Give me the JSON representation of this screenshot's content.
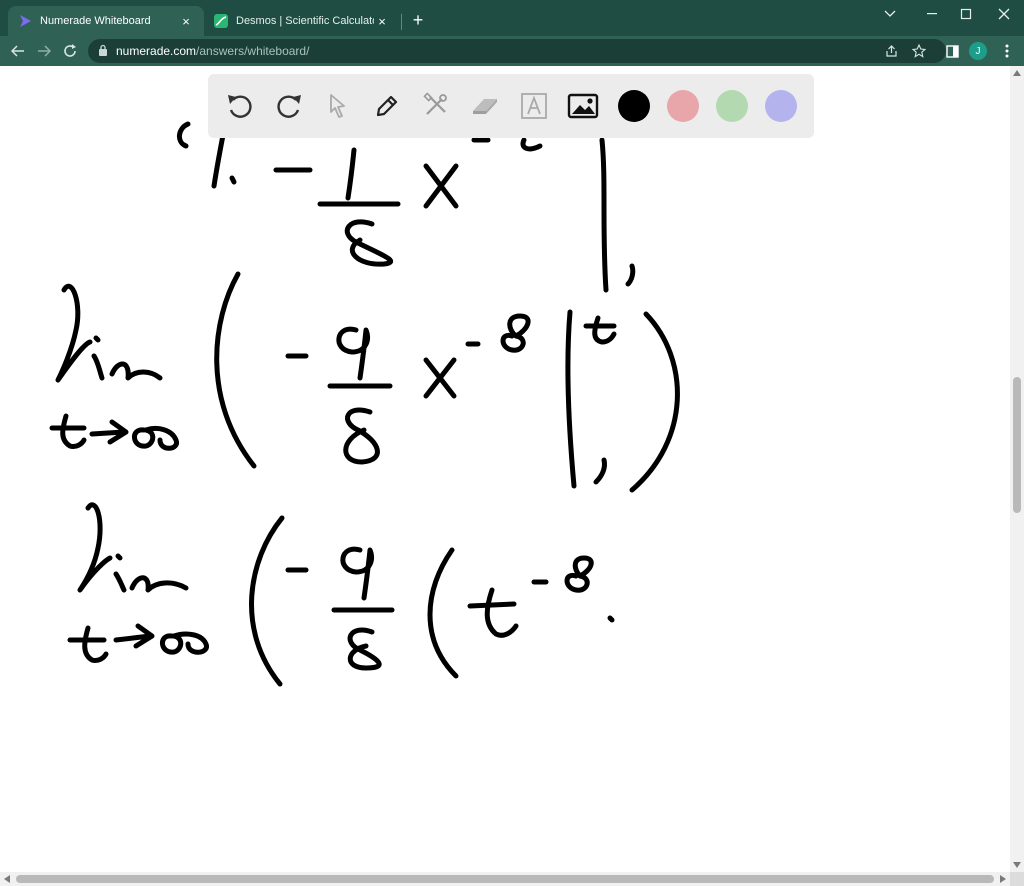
{
  "browser": {
    "tabs": [
      {
        "title": "Numerade Whiteboard",
        "active": true,
        "icon": "numerade-play-icon"
      },
      {
        "title": "Desmos | Scientific Calculator",
        "active": false,
        "icon": "desmos-graph-icon"
      }
    ],
    "close_glyph": "×",
    "new_tab_glyph": "+",
    "url_host": "numerade.com",
    "url_path": "/answers/whiteboard/",
    "profile_initial": "J",
    "window_controls": [
      "chevron-down-icon",
      "minimize-icon",
      "maximize-icon",
      "close-icon"
    ],
    "colors": {
      "frame": "#1f4d43",
      "toolbar": "#2f6154",
      "omnibox": "#1b3f37",
      "avatar": "#1c9e8a"
    }
  },
  "whiteboard": {
    "tools": [
      "undo-icon",
      "redo-icon",
      "select-cursor-icon",
      "pen-icon",
      "tools-icon",
      "eraser-icon",
      "text-icon",
      "image-icon"
    ],
    "colors": [
      "#000000",
      "#e8a6aa",
      "#b3d9b0",
      "#b5b3ee"
    ],
    "selected_color": "#000000"
  }
}
